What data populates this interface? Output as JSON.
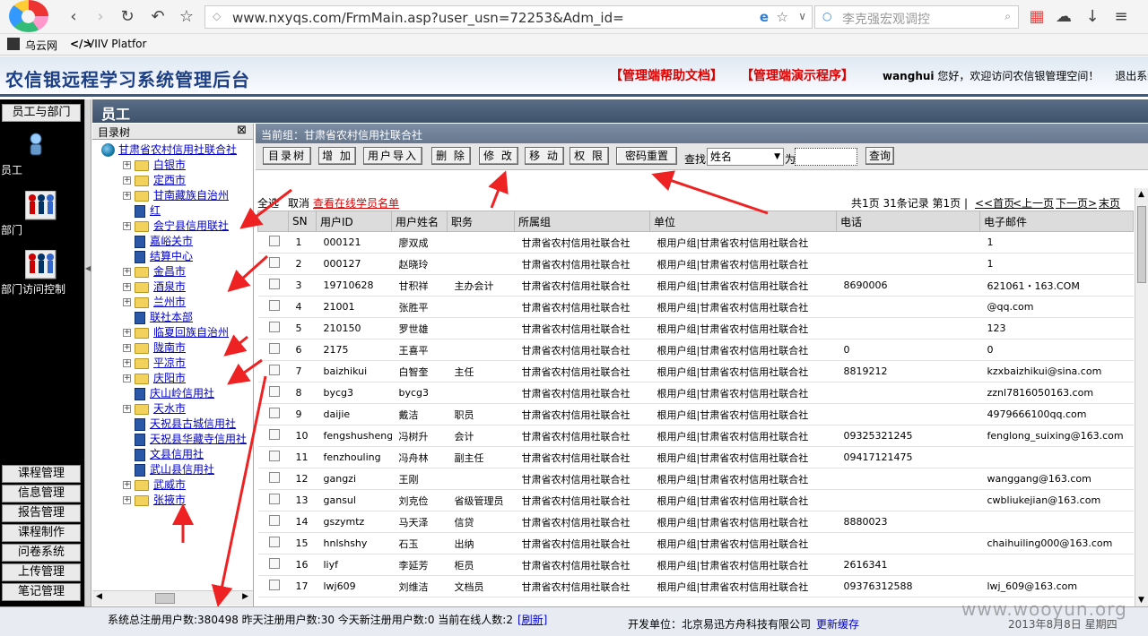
{
  "browser": {
    "url": "www.nxyqs.com/FrmMain.asp?user_usn=72253&Adm_id=",
    "search_placeholder": "李克强宏观调控",
    "bookmarks": [
      "乌云网",
      "VIIV Platfor"
    ]
  },
  "header": {
    "title": "农信银远程学习系统管理后台",
    "help_link": "【管理端帮助文档】",
    "demo_link": "【管理端演示程序】",
    "username": "wanghui",
    "welcome": "您好，欢迎访问农信银管理空间！",
    "logout": "退出系统"
  },
  "left_nav": {
    "top_button": "员工与部门",
    "items": [
      {
        "label": "员工",
        "icon": "employee-icon"
      },
      {
        "label": "部门",
        "icon": "department-icon"
      },
      {
        "label": "部门访问控制",
        "icon": "department-access-icon"
      }
    ],
    "bottom_buttons": [
      "课程管理",
      "信息管理",
      "报告管理",
      "课程制作",
      "问卷系统",
      "上传管理",
      "笔记管理"
    ]
  },
  "section_title": "员工",
  "tree": {
    "title": "目录树",
    "close": "⊠",
    "root": "甘肃省农村信用社联合社",
    "nodes": [
      {
        "label": "白银市",
        "type": "folder",
        "level": 1
      },
      {
        "label": "定西市",
        "type": "folder",
        "level": 1
      },
      {
        "label": "甘南藏族自治州",
        "type": "folder",
        "level": 1
      },
      {
        "label": "红",
        "type": "book",
        "level": 1
      },
      {
        "label": "会宁县信用联社",
        "type": "folder",
        "level": 1
      },
      {
        "label": "嘉峪关市",
        "type": "book",
        "level": 1
      },
      {
        "label": "结算中心",
        "type": "book",
        "level": 1
      },
      {
        "label": "金昌市",
        "type": "folder",
        "level": 1
      },
      {
        "label": "酒泉市",
        "type": "folder",
        "level": 1
      },
      {
        "label": "兰州市",
        "type": "folder",
        "level": 1
      },
      {
        "label": "联社本部",
        "type": "book",
        "level": 1
      },
      {
        "label": "临夏回族自治州",
        "type": "folder",
        "level": 1
      },
      {
        "label": "陇南市",
        "type": "folder",
        "level": 1
      },
      {
        "label": "平凉市",
        "type": "folder",
        "level": 1
      },
      {
        "label": "庆阳市",
        "type": "folder",
        "level": 1
      },
      {
        "label": "庆山岭信用社",
        "type": "book",
        "level": 1
      },
      {
        "label": "天水市",
        "type": "folder",
        "level": 1
      },
      {
        "label": "天祝县古城信用社",
        "type": "book",
        "level": 1
      },
      {
        "label": "天祝县华藏寺信用社",
        "type": "book",
        "level": 1
      },
      {
        "label": "文县信用社",
        "type": "book",
        "level": 1
      },
      {
        "label": "武山县信用社",
        "type": "book",
        "level": 1
      },
      {
        "label": "武威市",
        "type": "folder",
        "level": 1
      },
      {
        "label": "张掖市",
        "type": "folder",
        "level": 1
      }
    ]
  },
  "group_bar": "当前组：甘肃省农村信用社联合社",
  "toolbar": {
    "buttons": [
      "目录树",
      "增 加",
      "用户导入",
      "删 除",
      "修 改",
      "移 动",
      "权 限",
      "密码重置"
    ],
    "find_label": "查找",
    "find_field": "姓名",
    "for_label": "为",
    "query_button": "查询"
  },
  "list_info": {
    "select_all": "全选",
    "cancel": "取消",
    "online_link": "查看在线学员名单",
    "pager_text": "共1页 31条记录 第1页 |",
    "first": "<<首页",
    "prev": "<上一页",
    "next": "下一页>",
    "last": "末页>>"
  },
  "table": {
    "columns": [
      "SN",
      "用户ID",
      "用户姓名",
      "职务",
      "所属组",
      "单位",
      "电话",
      "电子邮件"
    ],
    "rows": [
      [
        "1",
        "000121",
        "廖双成",
        "",
        "甘肃省农村信用社联合社",
        "根用户组|甘肃省农村信用社联合社",
        "",
        "1"
      ],
      [
        "2",
        "000127",
        "赵晓玲",
        "",
        "甘肃省农村信用社联合社",
        "根用户组|甘肃省农村信用社联合社",
        "",
        "1"
      ],
      [
        "3",
        "19710628",
        "甘积祥",
        "主办会计",
        "甘肃省农村信用社联合社",
        "根用户组|甘肃省农村信用社联合社",
        "8690006",
        "621061・163.COM"
      ],
      [
        "4",
        "21001",
        "张胜平",
        "",
        "甘肃省农村信用社联合社",
        "根用户组|甘肃省农村信用社联合社",
        "",
        "@qq.com"
      ],
      [
        "5",
        "210150",
        "罗世雄",
        "",
        "甘肃省农村信用社联合社",
        "根用户组|甘肃省农村信用社联合社",
        "",
        "123"
      ],
      [
        "6",
        "2175",
        "王喜平",
        "",
        "甘肃省农村信用社联合社",
        "根用户组|甘肃省农村信用社联合社",
        "0",
        "0"
      ],
      [
        "7",
        "baizhikui",
        "白智奎",
        "主任",
        "甘肃省农村信用社联合社",
        "根用户组|甘肃省农村信用社联合社",
        "8819212",
        "kzxbaizhikui@sina.com"
      ],
      [
        "8",
        "bycg3",
        "bycg3",
        "",
        "甘肃省农村信用社联合社",
        "根用户组|甘肃省农村信用社联合社",
        "",
        "zznl7816050163.com"
      ],
      [
        "9",
        "daijie",
        "戴洁",
        "职员",
        "甘肃省农村信用社联合社",
        "根用户组|甘肃省农村信用社联合社",
        "",
        "4979666100qq.com"
      ],
      [
        "10",
        "fengshusheng",
        "冯树升",
        "会计",
        "甘肃省农村信用社联合社",
        "根用户组|甘肃省农村信用社联合社",
        "09325321245",
        "fenglong_suixing@163.com"
      ],
      [
        "11",
        "fenzhouling",
        "冯舟林",
        "副主任",
        "甘肃省农村信用社联合社",
        "根用户组|甘肃省农村信用社联合社",
        "09417121475",
        ""
      ],
      [
        "12",
        "gangzi",
        "王刚",
        "",
        "甘肃省农村信用社联合社",
        "根用户组|甘肃省农村信用社联合社",
        "",
        "wanggang@163.com"
      ],
      [
        "13",
        "gansul",
        "刘克俭",
        "省级管理员",
        "甘肃省农村信用社联合社",
        "根用户组|甘肃省农村信用社联合社",
        "",
        "cwbliukejian@163.com"
      ],
      [
        "14",
        "gszymtz",
        "马天泽",
        "信贷",
        "甘肃省农村信用社联合社",
        "根用户组|甘肃省农村信用社联合社",
        "8880023",
        ""
      ],
      [
        "15",
        "hnlshshy",
        "石玉",
        "出纳",
        "甘肃省农村信用社联合社",
        "根用户组|甘肃省农村信用社联合社",
        "",
        "chaihuiling000@163.com"
      ],
      [
        "16",
        "liyf",
        "李延芳",
        "柜员",
        "甘肃省农村信用社联合社",
        "根用户组|甘肃省农村信用社联合社",
        "2616341",
        ""
      ],
      [
        "17",
        "lwj609",
        "刘维洁",
        "文档员",
        "甘肃省农村信用社联合社",
        "根用户组|甘肃省农村信用社联合社",
        "09376312588",
        "lwj_609@163.com"
      ]
    ]
  },
  "status": {
    "stats": "系统总注册用户数:380498 昨天注册用户数:30 今天新注册用户数:0 当前在线人数:2",
    "refresh": "[刷新]",
    "developer": "开发单位：北京易迅方舟科技有限公司",
    "update_cache": "更新缓存",
    "date": "2013年8月8日 星期四"
  },
  "watermark": "www.wooyun.org",
  "colors": {
    "title_blue": "#1d3f86",
    "link_red": "#dd0000",
    "arrow_red": "#ee2222"
  }
}
